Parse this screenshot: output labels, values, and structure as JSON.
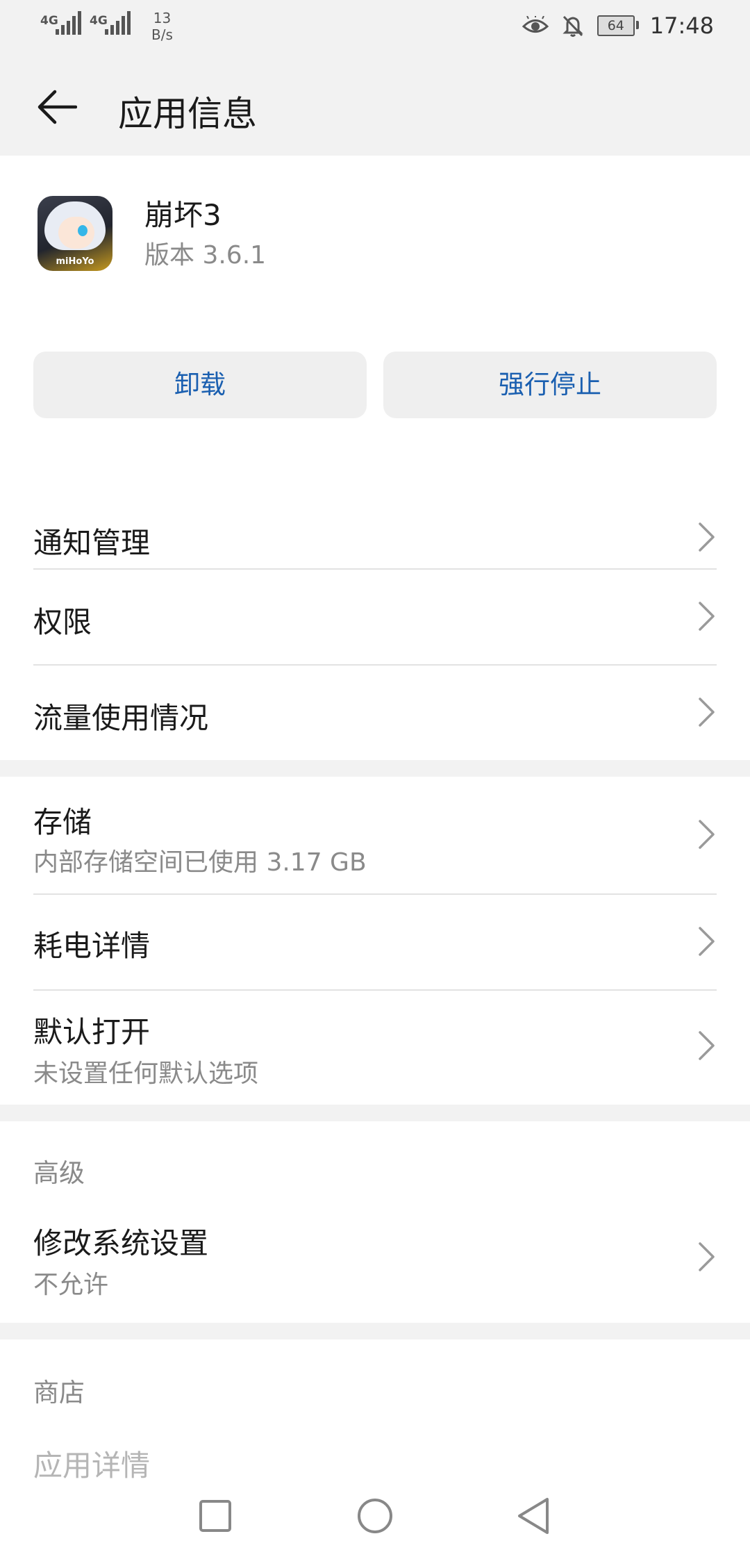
{
  "status_bar": {
    "sim1": "4G",
    "sim2": "4G",
    "net_speed_value": "13",
    "net_speed_unit": "B/s",
    "battery": "64",
    "time": "17:48"
  },
  "app_bar": {
    "title": "应用信息"
  },
  "app": {
    "name": "崩坏3",
    "version": "版本 3.6.1",
    "icon_logo": "miHoYo"
  },
  "buttons": {
    "uninstall": "卸载",
    "force_stop": "强行停止"
  },
  "section1": [
    {
      "label": "通知管理"
    },
    {
      "label": "权限"
    },
    {
      "label": "流量使用情况"
    }
  ],
  "section2": [
    {
      "label": "存储",
      "sub": "内部存储空间已使用 3.17 GB"
    },
    {
      "label": "耗电详情"
    },
    {
      "label": "默认打开",
      "sub": "未设置任何默认选项"
    }
  ],
  "advanced": {
    "header": "高级",
    "item": {
      "label": "修改系统设置",
      "sub": "不允许"
    }
  },
  "store": {
    "header": "商店",
    "item": {
      "label": "应用详情"
    }
  },
  "colors": {
    "accent": "#1a5fb0",
    "background": "#f2f2f2",
    "secondary_text": "#8a8a8a"
  }
}
